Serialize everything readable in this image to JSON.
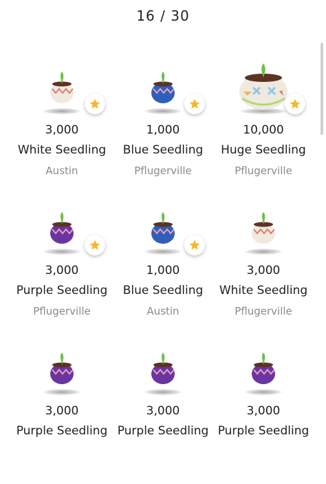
{
  "header": {
    "counter": "16 / 30"
  },
  "colors": {
    "star": "#F5B82E",
    "white_pot": "#EFE9DF",
    "blue_pot": "#2F5FB8",
    "purple_pot": "#6A35A0",
    "leaf": "#6CC04A"
  },
  "items": [
    {
      "amount": "3,000",
      "name": "White Seedling",
      "city": "Austin",
      "pot": "white",
      "star": true
    },
    {
      "amount": "1,000",
      "name": "Blue Seedling",
      "city": "Pflugerville",
      "pot": "blue",
      "star": true
    },
    {
      "amount": "10,000",
      "name": "Huge Seedling",
      "city": "Pflugerville",
      "pot": "huge",
      "star": true
    },
    {
      "amount": "3,000",
      "name": "Purple Seedling",
      "city": "Pflugerville",
      "pot": "purple",
      "star": true
    },
    {
      "amount": "1,000",
      "name": "Blue Seedling",
      "city": "Austin",
      "pot": "blue",
      "star": true
    },
    {
      "amount": "3,000",
      "name": "White Seedling",
      "city": "Pflugerville",
      "pot": "white",
      "star": false
    },
    {
      "amount": "3,000",
      "name": "Purple Seedling",
      "city": "",
      "pot": "purple",
      "star": false
    },
    {
      "amount": "3,000",
      "name": "Purple Seedling",
      "city": "",
      "pot": "purple",
      "star": false
    },
    {
      "amount": "3,000",
      "name": "Purple Seedling",
      "city": "",
      "pot": "purple",
      "star": false
    }
  ]
}
